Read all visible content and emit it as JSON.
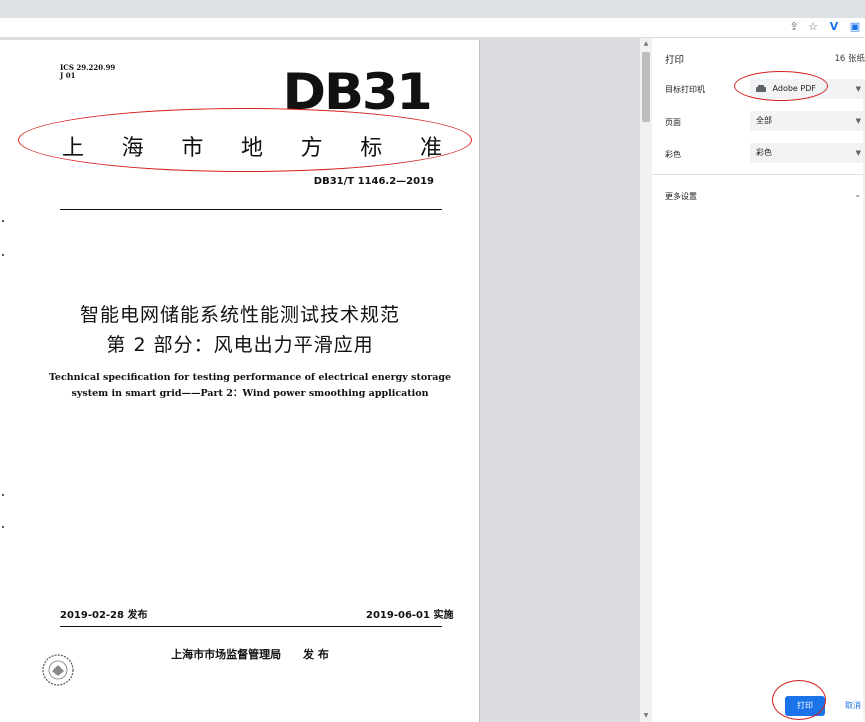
{
  "document": {
    "ics_line1": "ICS 29.220.99",
    "ics_line2": "J 01",
    "logo_text": "DB31",
    "standard_title_chars": [
      "上",
      "海",
      "市",
      "地",
      "方",
      "标",
      "准"
    ],
    "standard_number": "DB31/T 1146.2—2019",
    "cn_title_line1": "智能电网储能系统性能测试技术规范",
    "cn_title_line2": "第 2 部分：风电出力平滑应用",
    "en_title_line1": "Technical specification for testing performance of electrical energy storage",
    "en_title_line2": "system in smart grid——Part 2：Wind power smoothing application",
    "publish_date": "2019-02-28 发布",
    "effective_date": "2019-06-01 实施",
    "issuer": "上海市市场监督管理局",
    "issuer_suffix": "发 布"
  },
  "print_panel": {
    "title": "打印",
    "page_count": "16 张纸",
    "destination_label": "目标打印机",
    "destination_value": "Adobe PDF",
    "pages_label": "页面",
    "pages_value": "全部",
    "color_label": "彩色",
    "color_value": "彩色",
    "more_settings": "更多设置",
    "print_button": "打印",
    "cancel_button": "取消"
  },
  "colors": {
    "annotation_red": "#d62020",
    "print_blue": "#1a73e8"
  }
}
